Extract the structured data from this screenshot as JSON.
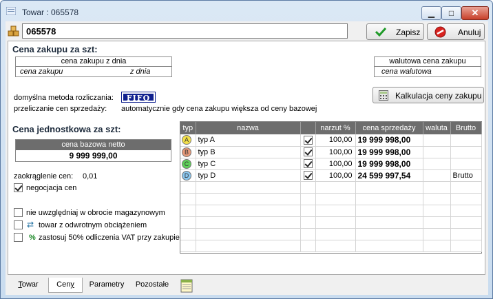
{
  "window": {
    "title": "Towar : 065578",
    "min_glyph": "▁",
    "max_glyph": "□",
    "close_glyph": "✕"
  },
  "header": {
    "code_value": "065578",
    "save_label": "Zapisz",
    "cancel_label": "Anuluj"
  },
  "purchase": {
    "title": "Cena zakupu za szt:",
    "box_head": "cena zakupu z dnia",
    "col_price": "cena zakupu",
    "col_date": "z dnia",
    "currency_head": "walutowa cena zakupu",
    "currency_value": "cena walutowa",
    "calc_label": "Kalkulacja ceny zakupu"
  },
  "settlement": {
    "method_label": "domyślna metoda rozliczania:",
    "method_value": "FIFO",
    "recalc_label": "przeliczanie cen sprzedaży:",
    "recalc_value": "automatycznie gdy cena zakupu większa od ceny bazowej"
  },
  "unit_price": {
    "title": "Cena jednostkowa za szt:",
    "base_head": "cena bazowa netto",
    "base_value": "9 999 999,00",
    "rounding_label": "zaokrąglenie cen:",
    "rounding_value": "0,01",
    "negotiation_label": "negocjacja cen"
  },
  "options": {
    "opt1": "nie uwzględniaj w obrocie magazynowym",
    "opt2": "towar z odwrotnym obciążeniem",
    "opt3": "zastosuj 50% odliczenia VAT przy zakupie",
    "opt2_icon": "⇄",
    "opt3_icon": "%"
  },
  "grid": {
    "headers": [
      "typ",
      "nazwa",
      "",
      "narzut %",
      "cena sprzedaży",
      "waluta",
      "Brutto"
    ],
    "rows": [
      {
        "badge": "A",
        "color": "#f3e04a",
        "name": "typ A",
        "markup": "100,00",
        "price": "19 999 998,00",
        "currency": "",
        "brutto": ""
      },
      {
        "badge": "B",
        "color": "#e89a7a",
        "name": "typ B",
        "markup": "100,00",
        "price": "19 999 998,00",
        "currency": "",
        "brutto": ""
      },
      {
        "badge": "C",
        "color": "#5fd05a",
        "name": "typ C",
        "markup": "100,00",
        "price": "19 999 998,00",
        "currency": "",
        "brutto": ""
      },
      {
        "badge": "D",
        "color": "#8ac6ee",
        "name": "typ D",
        "markup": "100,00",
        "price": "24 599 997,54",
        "currency": "",
        "brutto": "Brutto"
      }
    ]
  },
  "tabs": [
    {
      "label": "Towar",
      "hotkey": "T",
      "rest": "owar"
    },
    {
      "label": "Ceny",
      "hotkey": "y",
      "rest": "Cen"
    },
    {
      "label": "Parametry",
      "hotkey": "m",
      "rest": "Para"
    },
    {
      "label": "Pozostałe",
      "hotkey": "o",
      "rest": "P"
    }
  ]
}
